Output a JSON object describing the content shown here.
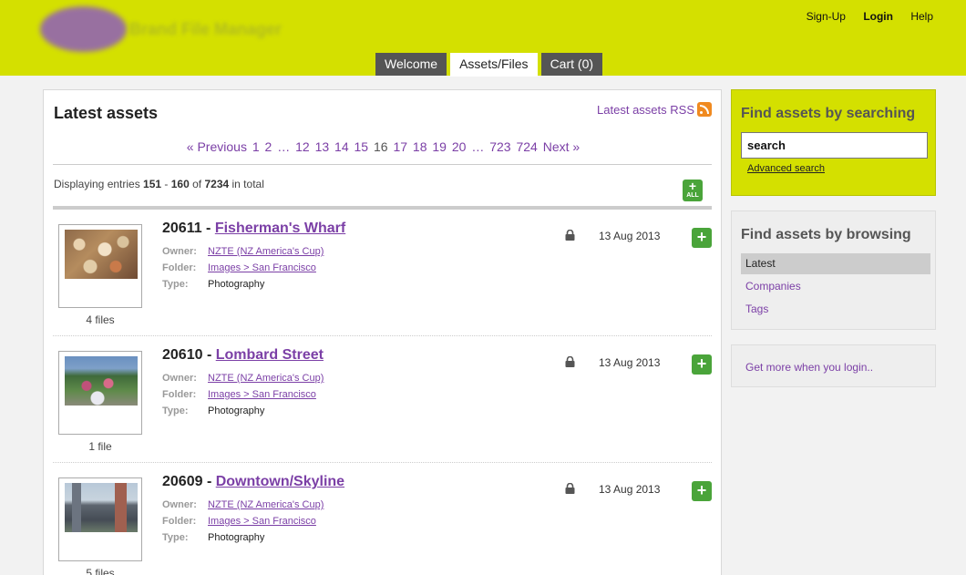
{
  "header": {
    "links": [
      "Sign-Up",
      "Login",
      "Help"
    ],
    "tabs": [
      "Welcome",
      "Assets/Files",
      "Cart (0)"
    ],
    "accent": "#d4e000"
  },
  "main": {
    "title": "Latest assets",
    "rss": "Latest assets RSS",
    "pager": {
      "prev": "« Previous",
      "pages_a": [
        "1",
        "2"
      ],
      "dots": "…",
      "pages_b": [
        "12",
        "13",
        "14",
        "15"
      ],
      "current": "16",
      "pages_c": [
        "17",
        "18",
        "19",
        "20"
      ],
      "pages_d": [
        "723",
        "724"
      ],
      "next": "Next »"
    },
    "display": {
      "prefix": "Displaying entries ",
      "from": "151",
      "dash": " - ",
      "to": "160",
      "of": " of ",
      "total": "7234",
      "suffix": " in total"
    },
    "add_all": "ALL",
    "labels": {
      "owner": "Owner:",
      "folder": "Folder:",
      "type": "Type:"
    },
    "assets": [
      {
        "id": "20611",
        "sep": " - ",
        "name": "Fisherman's Wharf",
        "owner": "NZTE (NZ America's Cup)",
        "folder": "Images > San Francisco",
        "type": "Photography",
        "date": "13 Aug 2013",
        "files": "4 files"
      },
      {
        "id": "20610",
        "sep": " - ",
        "name": "Lombard Street",
        "owner": "NZTE (NZ America's Cup)",
        "folder": "Images > San Francisco",
        "type": "Photography",
        "date": "13 Aug 2013",
        "files": "1 file"
      },
      {
        "id": "20609",
        "sep": " - ",
        "name": "Downtown/Skyline",
        "owner": "NZTE (NZ America's Cup)",
        "folder": "Images > San Francisco",
        "type": "Photography",
        "date": "13 Aug 2013",
        "files": "5 files"
      }
    ]
  },
  "sidebar": {
    "search_title": "Find assets by searching",
    "search_value": "search",
    "advanced": "Advanced search",
    "browse_title": "Find assets by browsing",
    "browse_items": [
      "Latest",
      "Companies",
      "Tags"
    ],
    "login_text": "Get more when you login.."
  }
}
